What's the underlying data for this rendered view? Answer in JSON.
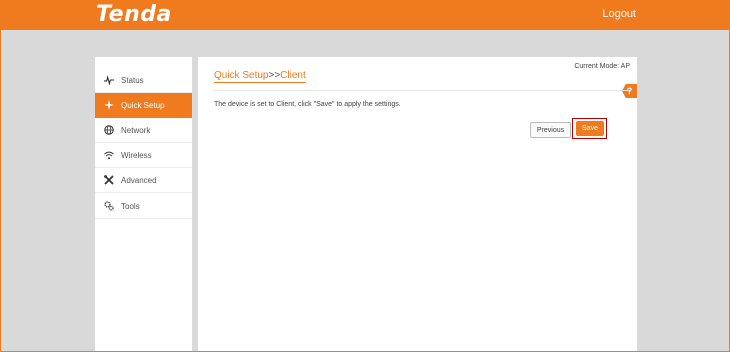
{
  "header": {
    "logo": "Tenda",
    "logout": "Logout"
  },
  "sidebar": {
    "items": [
      {
        "label": "Status",
        "icon": "status-icon",
        "active": false
      },
      {
        "label": "Quick Setup",
        "icon": "quick-setup-icon",
        "active": true
      },
      {
        "label": "Network",
        "icon": "globe-icon",
        "active": false
      },
      {
        "label": "Wireless",
        "icon": "wifi-icon",
        "active": false
      },
      {
        "label": "Advanced",
        "icon": "tools-cross-icon",
        "active": false
      },
      {
        "label": "Tools",
        "icon": "gears-icon",
        "active": false
      }
    ]
  },
  "main": {
    "mode": "Current Mode: AP",
    "breadcrumb": {
      "first": "Quick Setup",
      "separator": ">>",
      "second": "Client"
    },
    "help": "?",
    "message": "The device is set to Client, click \"Save\" to apply the settings.",
    "previous": "Previous",
    "save": "Save"
  },
  "colors": {
    "accent": "#f07a1e",
    "background": "#d9d9d9",
    "highlight": "#bb0000"
  }
}
